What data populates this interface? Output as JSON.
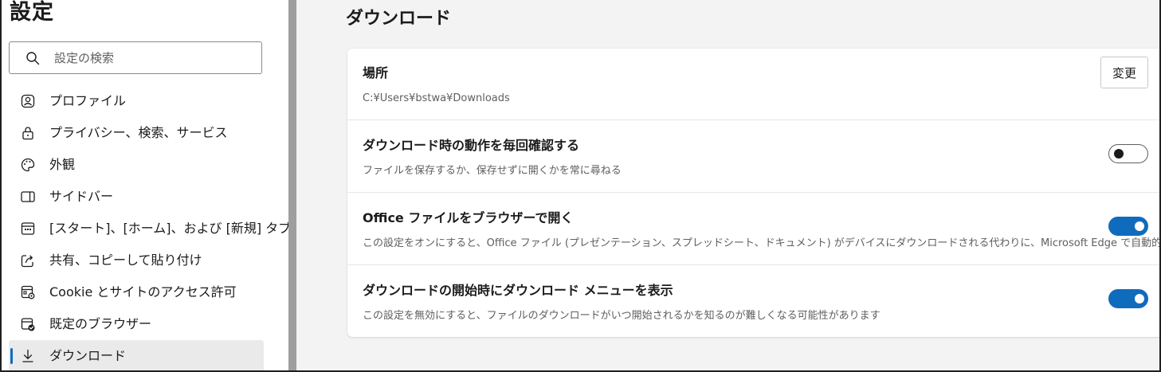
{
  "sidebar": {
    "title": "設定",
    "search": {
      "placeholder": "設定の検索",
      "value": ""
    },
    "items": [
      {
        "label": "プロファイル",
        "icon": "profile-icon",
        "active": false
      },
      {
        "label": "プライバシー、検索、サービス",
        "icon": "lock-icon",
        "active": false
      },
      {
        "label": "外観",
        "icon": "palette-icon",
        "active": false
      },
      {
        "label": "サイドバー",
        "icon": "sidebar-icon",
        "active": false
      },
      {
        "label": "[スタート]、[ホーム]、および [新規] タブ",
        "icon": "home-tabs-icon",
        "active": false
      },
      {
        "label": "共有、コピーして貼り付け",
        "icon": "share-icon",
        "active": false
      },
      {
        "label": "Cookie とサイトのアクセス許可",
        "icon": "site-permissions-icon",
        "active": false
      },
      {
        "label": "既定のブラウザー",
        "icon": "default-browser-icon",
        "active": false
      },
      {
        "label": "ダウンロード",
        "icon": "download-icon",
        "active": true
      }
    ]
  },
  "main": {
    "title": "ダウンロード",
    "location": {
      "title": "場所",
      "path": "C:¥Users¥bstwa¥Downloads",
      "button_label": "変更"
    },
    "settings": [
      {
        "title": "ダウンロード時の動作を毎回確認する",
        "description": "ファイルを保存するか、保存せずに開くかを常に尋ねる",
        "enabled": false
      },
      {
        "title": "Office ファイルをブラウザーで開く",
        "description": "この設定をオンにすると、Office ファイル (プレゼンテーション、スプレッドシート、ドキュメント) がデバイスにダウンロードされる代わりに、Microsoft Edge で自動的に開きます",
        "enabled": true
      },
      {
        "title": "ダウンロードの開始時にダウンロード メニューを表示",
        "description": "この設定を無効にすると、ファイルのダウンロードがいつ開始されるかを知るのが難しくなる可能性があります",
        "enabled": true
      }
    ]
  },
  "colors": {
    "accent": "#0f6cbd",
    "main_background": "#f3f3f3",
    "active_item_background": "#eaeaea",
    "divider": "#9e9e9e"
  }
}
